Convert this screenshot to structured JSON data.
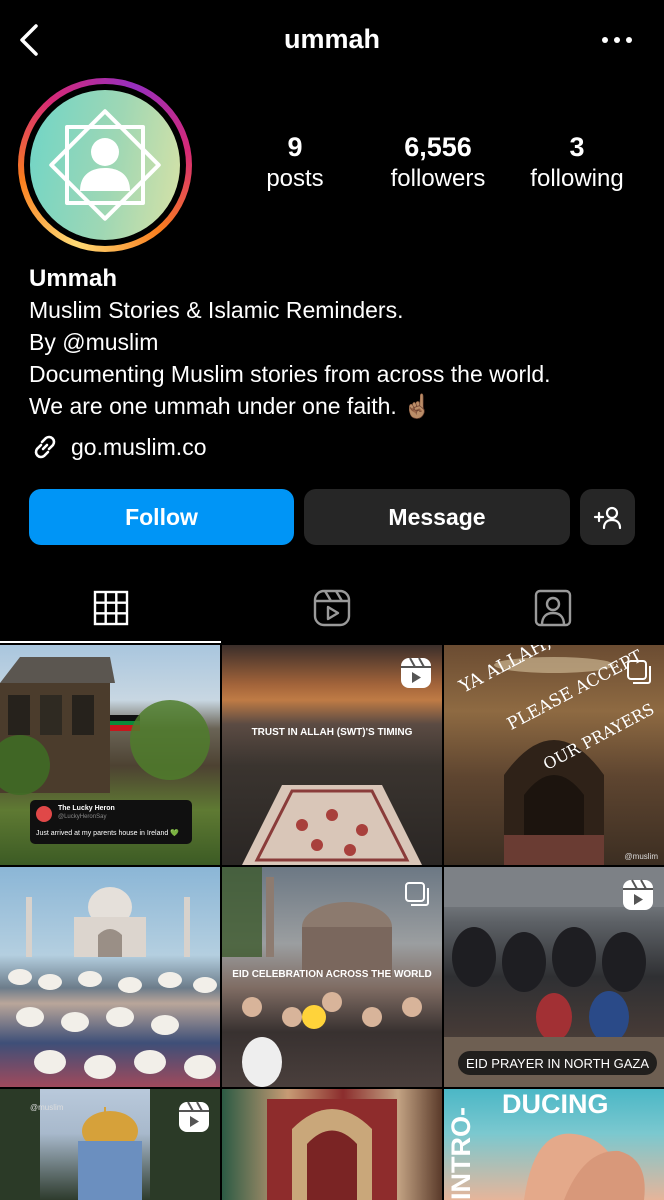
{
  "header": {
    "username": "ummah"
  },
  "stats": [
    {
      "value": "9",
      "label": "posts"
    },
    {
      "value": "6,556",
      "label": "followers"
    },
    {
      "value": "3",
      "label": "following"
    }
  ],
  "bio": {
    "name": "Ummah",
    "lines": [
      "Muslim Stories & Islamic Reminders.",
      "By @muslim",
      "Documenting Muslim stories from across the world.",
      "We are one ummah under one faith. ☝🏽"
    ],
    "link": "go.muslim.co"
  },
  "buttons": {
    "follow": "Follow",
    "message": "Message"
  },
  "posts": {
    "p1": {
      "author": "The Lucky Heron",
      "handle": "@LuckyHeronSay",
      "text": "Just arrived at my parents house in Ireland 💚"
    },
    "p2": {
      "caption": "TRUST IN ALLAH (SWT)'S TIMING"
    },
    "p3": {
      "line1": "YA ALLAH,",
      "line2": "PLEASE ACCEPT",
      "line3": "OUR PRAYERS",
      "watermark": "@muslim"
    },
    "p5": {
      "caption": "EID CELEBRATION ACROSS THE WORLD"
    },
    "p6": {
      "caption": "EID PRAYER IN NORTH GAZA"
    },
    "p7": {
      "watermark": "@muslim"
    },
    "p9": {
      "line1": "DUCING",
      "line2": "INTRO-"
    }
  },
  "colors": {
    "follow_button": "#0095f6",
    "secondary_button": "#262626",
    "background": "#000000"
  }
}
